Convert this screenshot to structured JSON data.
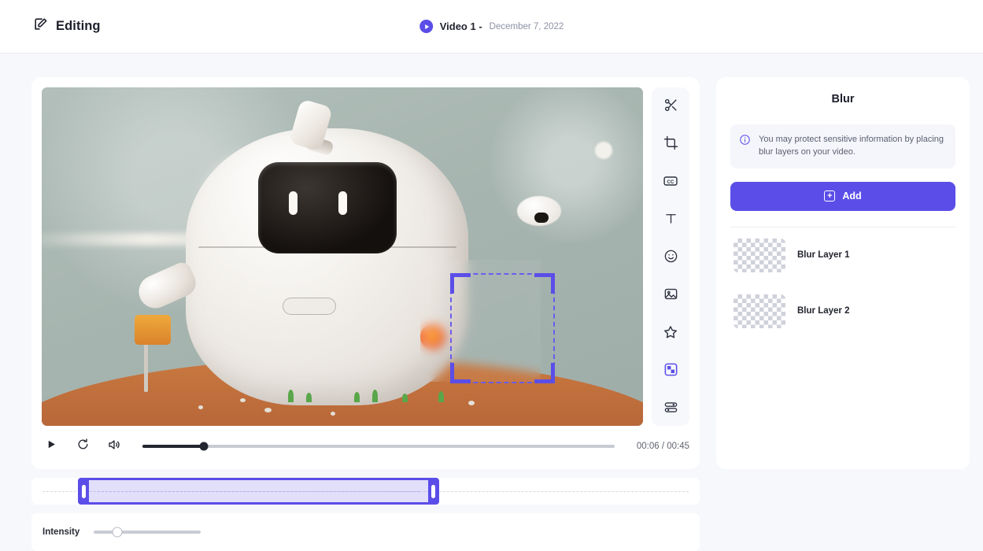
{
  "header": {
    "brand_label": "Editing",
    "brand_icon": "edit-square-icon",
    "play_icon": "play-circle-icon",
    "video_name": "Video 1 -",
    "video_date": "December 7, 2022"
  },
  "toolbar": {
    "items": [
      {
        "name": "cut",
        "icon": "scissors-icon",
        "active": false
      },
      {
        "name": "crop",
        "icon": "crop-icon",
        "active": false
      },
      {
        "name": "captions",
        "icon": "closed-caption-icon",
        "active": false
      },
      {
        "name": "text",
        "icon": "text-icon",
        "active": false
      },
      {
        "name": "emoji",
        "icon": "smiley-icon",
        "active": false
      },
      {
        "name": "image",
        "icon": "image-icon",
        "active": false
      },
      {
        "name": "effects",
        "icon": "star-icon",
        "active": false
      },
      {
        "name": "blur",
        "icon": "blur-checker-icon",
        "active": true
      },
      {
        "name": "adjust",
        "icon": "sliders-icon",
        "active": false
      }
    ]
  },
  "player": {
    "play_icon": "play-icon",
    "restart_icon": "restart-icon",
    "volume_icon": "volume-icon",
    "seek_percent": 13,
    "time_display": "00:06 / 00:45",
    "current_time": "00:06",
    "duration": "00:45"
  },
  "timeline": {
    "trim_start_percent": 7,
    "trim_width_percent": 54,
    "left_handle": "trim-handle-left",
    "right_handle": "trim-handle-right"
  },
  "intensity": {
    "label": "Intensity",
    "value_percent": 22
  },
  "selection": {
    "label": "blur-selection-region"
  },
  "panel": {
    "title": "Blur",
    "info_icon": "info-circle-icon",
    "info_text": "You may protect sensitive information by placing blur layers on your video.",
    "add_label": "Add",
    "add_icon": "plus-square-icon",
    "layers": [
      {
        "name": "Blur Layer 1"
      },
      {
        "name": "Blur Layer 2"
      }
    ]
  },
  "colors": {
    "accent": "#5b4ee8",
    "page_bg": "#f7f8fc",
    "card_bg": "#ffffff",
    "text_primary": "#1d1f2b",
    "text_muted": "#8d91a3"
  }
}
